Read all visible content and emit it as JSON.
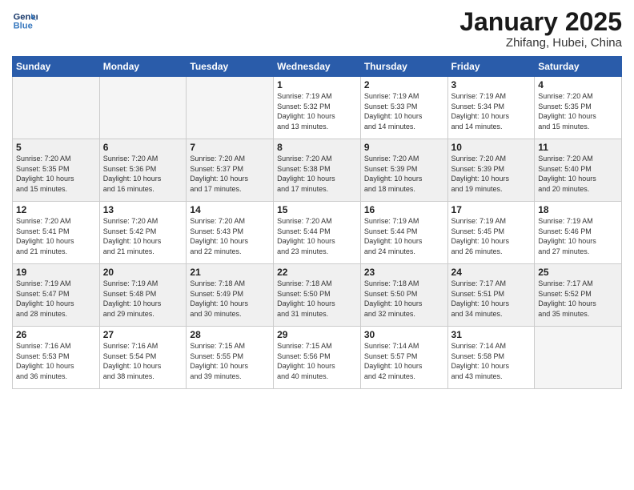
{
  "logo": {
    "line1": "General",
    "line2": "Blue"
  },
  "title": "January 2025",
  "subtitle": "Zhifang, Hubei, China",
  "days_of_week": [
    "Sunday",
    "Monday",
    "Tuesday",
    "Wednesday",
    "Thursday",
    "Friday",
    "Saturday"
  ],
  "weeks": [
    {
      "shaded": false,
      "days": [
        {
          "num": "",
          "info": ""
        },
        {
          "num": "",
          "info": ""
        },
        {
          "num": "",
          "info": ""
        },
        {
          "num": "1",
          "info": "Sunrise: 7:19 AM\nSunset: 5:32 PM\nDaylight: 10 hours\nand 13 minutes."
        },
        {
          "num": "2",
          "info": "Sunrise: 7:19 AM\nSunset: 5:33 PM\nDaylight: 10 hours\nand 14 minutes."
        },
        {
          "num": "3",
          "info": "Sunrise: 7:19 AM\nSunset: 5:34 PM\nDaylight: 10 hours\nand 14 minutes."
        },
        {
          "num": "4",
          "info": "Sunrise: 7:20 AM\nSunset: 5:35 PM\nDaylight: 10 hours\nand 15 minutes."
        }
      ]
    },
    {
      "shaded": true,
      "days": [
        {
          "num": "5",
          "info": "Sunrise: 7:20 AM\nSunset: 5:35 PM\nDaylight: 10 hours\nand 15 minutes."
        },
        {
          "num": "6",
          "info": "Sunrise: 7:20 AM\nSunset: 5:36 PM\nDaylight: 10 hours\nand 16 minutes."
        },
        {
          "num": "7",
          "info": "Sunrise: 7:20 AM\nSunset: 5:37 PM\nDaylight: 10 hours\nand 17 minutes."
        },
        {
          "num": "8",
          "info": "Sunrise: 7:20 AM\nSunset: 5:38 PM\nDaylight: 10 hours\nand 17 minutes."
        },
        {
          "num": "9",
          "info": "Sunrise: 7:20 AM\nSunset: 5:39 PM\nDaylight: 10 hours\nand 18 minutes."
        },
        {
          "num": "10",
          "info": "Sunrise: 7:20 AM\nSunset: 5:39 PM\nDaylight: 10 hours\nand 19 minutes."
        },
        {
          "num": "11",
          "info": "Sunrise: 7:20 AM\nSunset: 5:40 PM\nDaylight: 10 hours\nand 20 minutes."
        }
      ]
    },
    {
      "shaded": false,
      "days": [
        {
          "num": "12",
          "info": "Sunrise: 7:20 AM\nSunset: 5:41 PM\nDaylight: 10 hours\nand 21 minutes."
        },
        {
          "num": "13",
          "info": "Sunrise: 7:20 AM\nSunset: 5:42 PM\nDaylight: 10 hours\nand 21 minutes."
        },
        {
          "num": "14",
          "info": "Sunrise: 7:20 AM\nSunset: 5:43 PM\nDaylight: 10 hours\nand 22 minutes."
        },
        {
          "num": "15",
          "info": "Sunrise: 7:20 AM\nSunset: 5:44 PM\nDaylight: 10 hours\nand 23 minutes."
        },
        {
          "num": "16",
          "info": "Sunrise: 7:19 AM\nSunset: 5:44 PM\nDaylight: 10 hours\nand 24 minutes."
        },
        {
          "num": "17",
          "info": "Sunrise: 7:19 AM\nSunset: 5:45 PM\nDaylight: 10 hours\nand 26 minutes."
        },
        {
          "num": "18",
          "info": "Sunrise: 7:19 AM\nSunset: 5:46 PM\nDaylight: 10 hours\nand 27 minutes."
        }
      ]
    },
    {
      "shaded": true,
      "days": [
        {
          "num": "19",
          "info": "Sunrise: 7:19 AM\nSunset: 5:47 PM\nDaylight: 10 hours\nand 28 minutes."
        },
        {
          "num": "20",
          "info": "Sunrise: 7:19 AM\nSunset: 5:48 PM\nDaylight: 10 hours\nand 29 minutes."
        },
        {
          "num": "21",
          "info": "Sunrise: 7:18 AM\nSunset: 5:49 PM\nDaylight: 10 hours\nand 30 minutes."
        },
        {
          "num": "22",
          "info": "Sunrise: 7:18 AM\nSunset: 5:50 PM\nDaylight: 10 hours\nand 31 minutes."
        },
        {
          "num": "23",
          "info": "Sunrise: 7:18 AM\nSunset: 5:50 PM\nDaylight: 10 hours\nand 32 minutes."
        },
        {
          "num": "24",
          "info": "Sunrise: 7:17 AM\nSunset: 5:51 PM\nDaylight: 10 hours\nand 34 minutes."
        },
        {
          "num": "25",
          "info": "Sunrise: 7:17 AM\nSunset: 5:52 PM\nDaylight: 10 hours\nand 35 minutes."
        }
      ]
    },
    {
      "shaded": false,
      "days": [
        {
          "num": "26",
          "info": "Sunrise: 7:16 AM\nSunset: 5:53 PM\nDaylight: 10 hours\nand 36 minutes."
        },
        {
          "num": "27",
          "info": "Sunrise: 7:16 AM\nSunset: 5:54 PM\nDaylight: 10 hours\nand 38 minutes."
        },
        {
          "num": "28",
          "info": "Sunrise: 7:15 AM\nSunset: 5:55 PM\nDaylight: 10 hours\nand 39 minutes."
        },
        {
          "num": "29",
          "info": "Sunrise: 7:15 AM\nSunset: 5:56 PM\nDaylight: 10 hours\nand 40 minutes."
        },
        {
          "num": "30",
          "info": "Sunrise: 7:14 AM\nSunset: 5:57 PM\nDaylight: 10 hours\nand 42 minutes."
        },
        {
          "num": "31",
          "info": "Sunrise: 7:14 AM\nSunset: 5:58 PM\nDaylight: 10 hours\nand 43 minutes."
        },
        {
          "num": "",
          "info": ""
        }
      ]
    }
  ]
}
